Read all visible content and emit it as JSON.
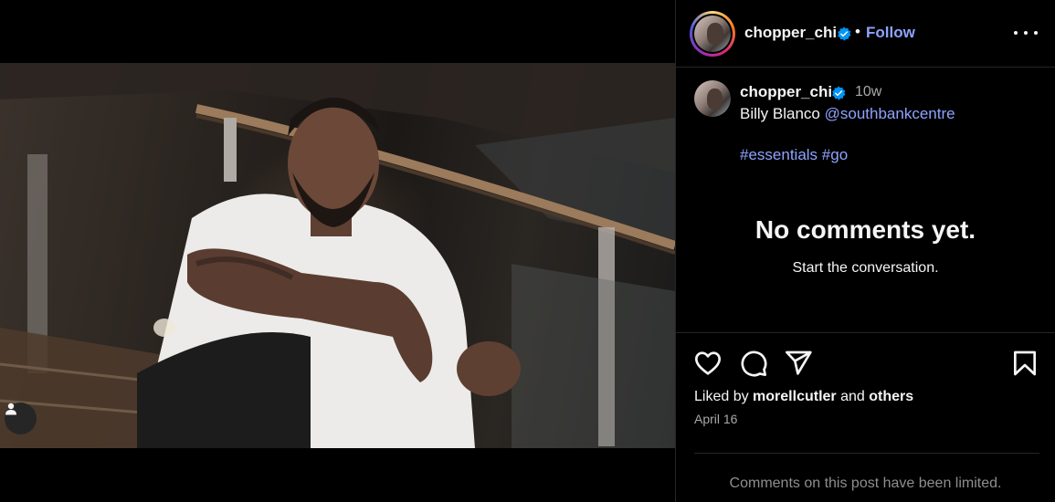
{
  "post": {
    "author": {
      "username": "chopper_chi",
      "verified": true
    },
    "header": {
      "separator": "•",
      "follow_label": "Follow",
      "more_icon": "more-horizontal-icon"
    },
    "caption": {
      "username": "chopper_chi",
      "time_ago": "10w",
      "text": "Billy Blanco",
      "mention": "@southbankcentre",
      "hashtags": [
        "#essentials",
        "#go"
      ]
    },
    "comments": {
      "empty_title": "No comments yet.",
      "empty_subtitle": "Start the conversation.",
      "limited_notice": "Comments on this post have been limited."
    },
    "actions": {
      "like_icon": "heart-icon",
      "comment_icon": "comment-icon",
      "share_icon": "share-icon",
      "save_icon": "bookmark-icon"
    },
    "likes": {
      "prefix": "Liked by",
      "user": "morellcutler",
      "connector": "and",
      "others": "others"
    },
    "date": "April 16",
    "media": {
      "type": "photo",
      "tag_icon": "user-tag-icon"
    }
  },
  "colors": {
    "background": "#000000",
    "link": "#8ea3ff",
    "verified": "#0095f6",
    "divider": "#262626",
    "muted": "#a8a8a8"
  }
}
